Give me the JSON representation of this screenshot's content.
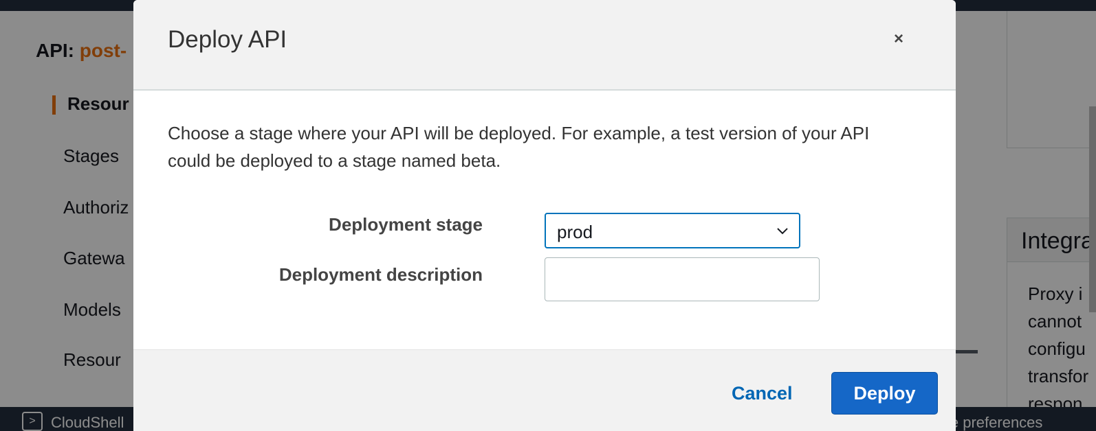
{
  "background": {
    "api_label": "API:",
    "api_name": "post-",
    "nav": {
      "active": "Resour",
      "items": [
        "Stages",
        "Authoriz",
        "Gatewa",
        "Models",
        "Resour"
      ]
    },
    "right_panel": {
      "heading": "Integra",
      "lines": [
        "Proxy i",
        "cannot",
        "configu",
        "transfor",
        "respon"
      ]
    },
    "bottom_bar": {
      "cloudshell_label": "CloudShell",
      "cookie_label": "kie preferences"
    }
  },
  "modal": {
    "title": "Deploy API",
    "close_symbol": "×",
    "description": "Choose a stage where your API will be deployed. For example, a test version of your API could be deployed to a stage named beta.",
    "stage_label": "Deployment stage",
    "stage_value": "prod",
    "description_label": "Deployment description",
    "description_value": "",
    "cancel_label": "Cancel",
    "deploy_label": "Deploy"
  },
  "colors": {
    "accent": "#ec7211",
    "primary_button": "#1567c7",
    "link": "#0066b4",
    "focus_border": "#0073bb"
  }
}
